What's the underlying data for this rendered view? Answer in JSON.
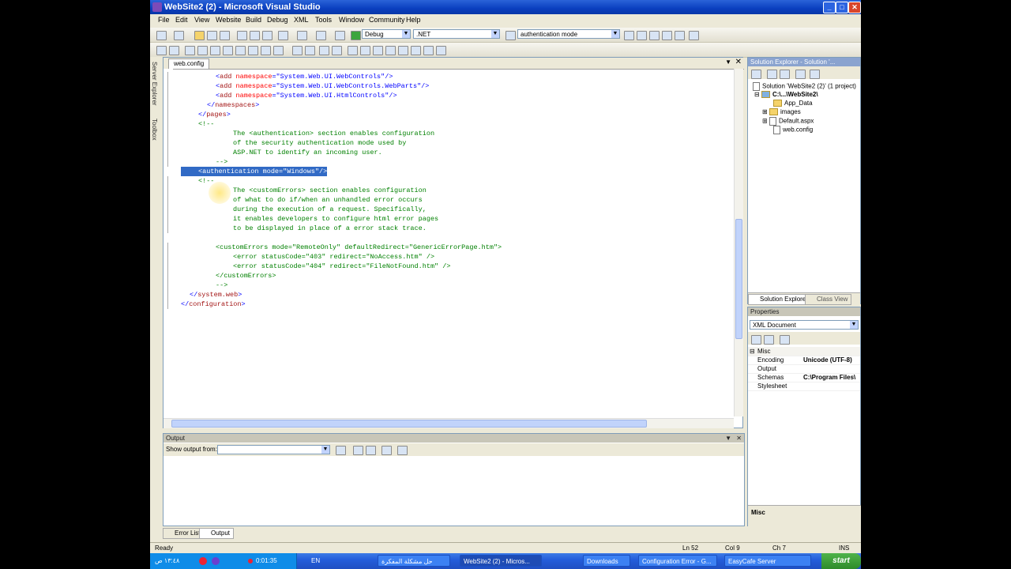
{
  "window": {
    "title": "WebSite2 (2) - Microsoft Visual Studio",
    "caption_buttons": [
      "minimize-icon",
      "maximize-icon",
      "close-icon"
    ]
  },
  "menu": [
    "File",
    "Edit",
    "View",
    "Website",
    "Build",
    "Debug",
    "XML",
    "Tools",
    "Window",
    "Community",
    "Help"
  ],
  "toolbar": {
    "config": "Debug",
    "platform": ".NET",
    "find": "authentication mode"
  },
  "left_tabs": [
    "Server Explorer",
    "Toolbox"
  ],
  "editor": {
    "tab": "web.config",
    "lines": [
      {
        "indent": 4,
        "type": "tag",
        "tag": "add",
        "attr": "namespace",
        "val": "System.Web.UI.WebControls",
        "close": "/>"
      },
      {
        "indent": 4,
        "type": "tag",
        "tag": "add",
        "attr": "namespace",
        "val": "System.Web.UI.WebControls.WebParts",
        "close": "/>"
      },
      {
        "indent": 4,
        "type": "tag",
        "tag": "add",
        "attr": "namespace",
        "val": "System.Web.UI.HtmlControls",
        "close": "/>"
      },
      {
        "indent": 3,
        "type": "end",
        "tag": "namespaces"
      },
      {
        "indent": 2,
        "type": "end",
        "tag": "pages"
      },
      {
        "indent": 2,
        "type": "comment",
        "text": "<!--"
      },
      {
        "indent": 6,
        "type": "comment",
        "text": "The <authentication> section enables configuration"
      },
      {
        "indent": 6,
        "type": "comment",
        "text": "of the security authentication mode used by"
      },
      {
        "indent": 6,
        "type": "comment",
        "text": "ASP.NET to identify an incoming user."
      },
      {
        "indent": 4,
        "type": "comment",
        "text": "-->"
      },
      {
        "indent": 2,
        "type": "selected",
        "text": "<authentication mode=\"Windows\"/>"
      },
      {
        "indent": 2,
        "type": "comment",
        "text": "<!--"
      },
      {
        "indent": 6,
        "type": "comment",
        "text": "The <customErrors> section enables configuration"
      },
      {
        "indent": 6,
        "type": "comment",
        "text": "of what to do if/when an unhandled error occurs"
      },
      {
        "indent": 6,
        "type": "comment",
        "text": "during the execution of a request. Specifically,"
      },
      {
        "indent": 6,
        "type": "comment",
        "text": "it enables developers to configure html error pages"
      },
      {
        "indent": 6,
        "type": "comment",
        "text": "to be displayed in place of a error stack trace."
      },
      {
        "indent": 0,
        "type": "blank",
        "text": ""
      },
      {
        "indent": 4,
        "type": "comment",
        "text": "<customErrors mode=\"RemoteOnly\" defaultRedirect=\"GenericErrorPage.htm\">"
      },
      {
        "indent": 6,
        "type": "comment",
        "text": "<error statusCode=\"403\" redirect=\"NoAccess.htm\" />"
      },
      {
        "indent": 6,
        "type": "comment",
        "text": "<error statusCode=\"404\" redirect=\"FileNotFound.htm\" />"
      },
      {
        "indent": 4,
        "type": "comment",
        "text": "</customErrors>"
      },
      {
        "indent": 4,
        "type": "comment",
        "text": "-->"
      },
      {
        "indent": 1,
        "type": "end",
        "tag": "system.web"
      },
      {
        "indent": 0,
        "type": "end",
        "tag": "configuration"
      }
    ]
  },
  "solution_explorer": {
    "title": "Solution Explorer - Solution '...",
    "items": [
      "Solution 'WebSite2 (2)' (1 project)",
      "C:\\...\\WebSite2\\",
      "App_Data",
      "images",
      "Default.aspx",
      "web.config"
    ],
    "tabs": [
      "Solution Explorer",
      "Class View"
    ]
  },
  "properties": {
    "title": "Properties",
    "object": "XML Document",
    "category": "Misc",
    "rows": [
      {
        "key": "Encoding",
        "value": "Unicode (UTF-8)"
      },
      {
        "key": "Output",
        "value": ""
      },
      {
        "key": "Schemas",
        "value": "C:\\Program Files\\"
      },
      {
        "key": "Stylesheet",
        "value": ""
      }
    ],
    "description": "Misc"
  },
  "output": {
    "title": "Output",
    "show_label": "Show output from:"
  },
  "bottom_tabs": [
    "Error List",
    "Output"
  ],
  "status": {
    "ready": "Ready",
    "ln": "Ln 52",
    "col": "Col 9",
    "ch": "Ch 7",
    "mode": "INS"
  },
  "taskbar": {
    "start": "start",
    "tasks": [
      "EasyCafe Server",
      "Configuration Error - G...",
      "Downloads",
      "WebSite2 (2) - Micros...",
      "حل مشكلة المفكرة"
    ],
    "lang": "EN",
    "timer": "0:01:35",
    "clock": "١٣:٤٨ ص"
  }
}
